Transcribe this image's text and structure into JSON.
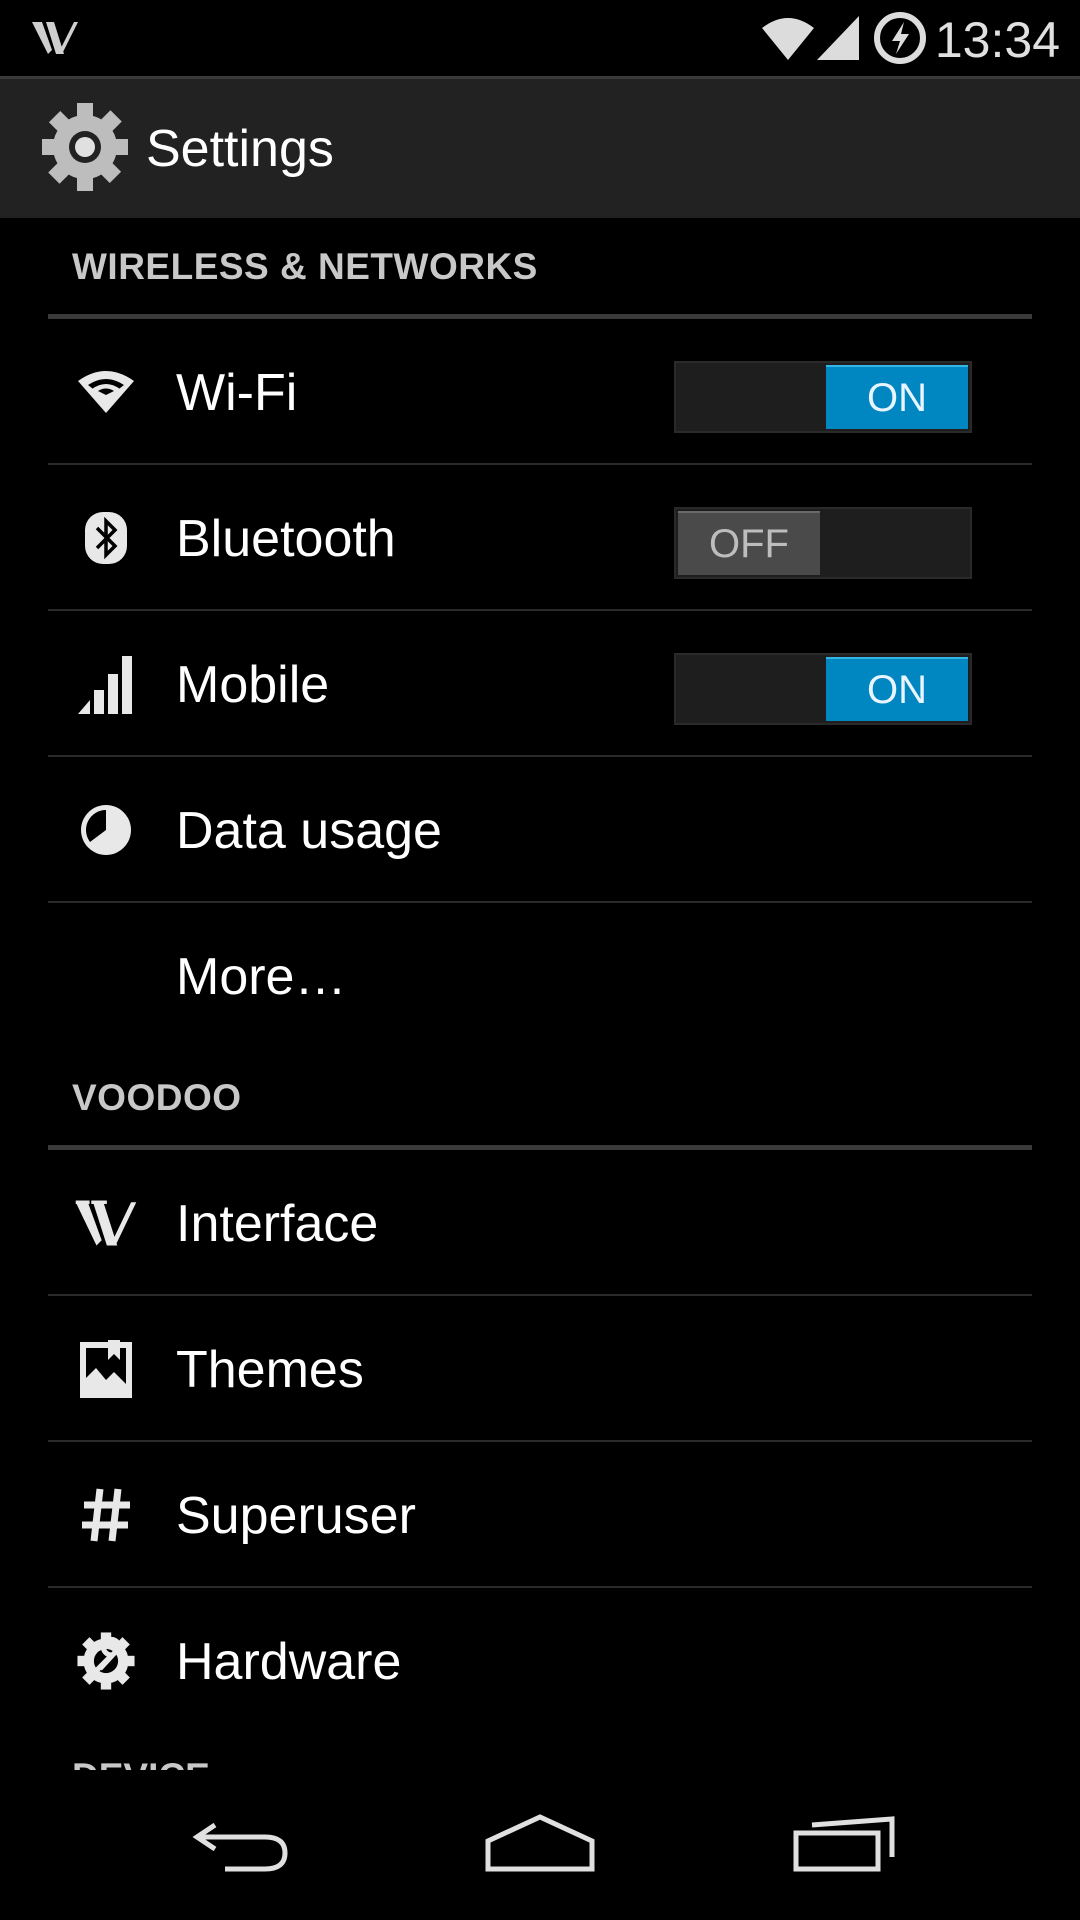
{
  "status_bar": {
    "app_logo_icon": "voodoo-logo-icon",
    "time": "13:34",
    "icons": [
      "wifi-icon",
      "signal-icon",
      "charging-battery-icon"
    ]
  },
  "action_bar": {
    "title": "Settings",
    "icon": "settings-gear-icon"
  },
  "sections": [
    {
      "header": "WIRELESS & NETWORKS",
      "items": [
        {
          "label": "Wi-Fi",
          "icon": "wifi-icon",
          "toggle": "ON"
        },
        {
          "label": "Bluetooth",
          "icon": "bluetooth-icon",
          "toggle": "OFF"
        },
        {
          "label": "Mobile",
          "icon": "signal-icon",
          "toggle": "ON"
        },
        {
          "label": "Data usage",
          "icon": "data-usage-icon"
        },
        {
          "label": "More…"
        }
      ]
    },
    {
      "header": "VOODOO",
      "items": [
        {
          "label": "Interface",
          "icon": "voodoo-logo-icon"
        },
        {
          "label": "Themes",
          "icon": "themes-icon"
        },
        {
          "label": "Superuser",
          "icon": "hash-icon"
        },
        {
          "label": "Hardware",
          "icon": "hardware-wrench-icon"
        }
      ]
    },
    {
      "header": "DEVICE"
    }
  ],
  "nav_bar": [
    "back-icon",
    "home-icon",
    "recent-apps-icon"
  ],
  "colors": {
    "accent": "#0086c0",
    "background": "#000000",
    "action_bar": "#222222",
    "divider": "#3a3a3a"
  }
}
